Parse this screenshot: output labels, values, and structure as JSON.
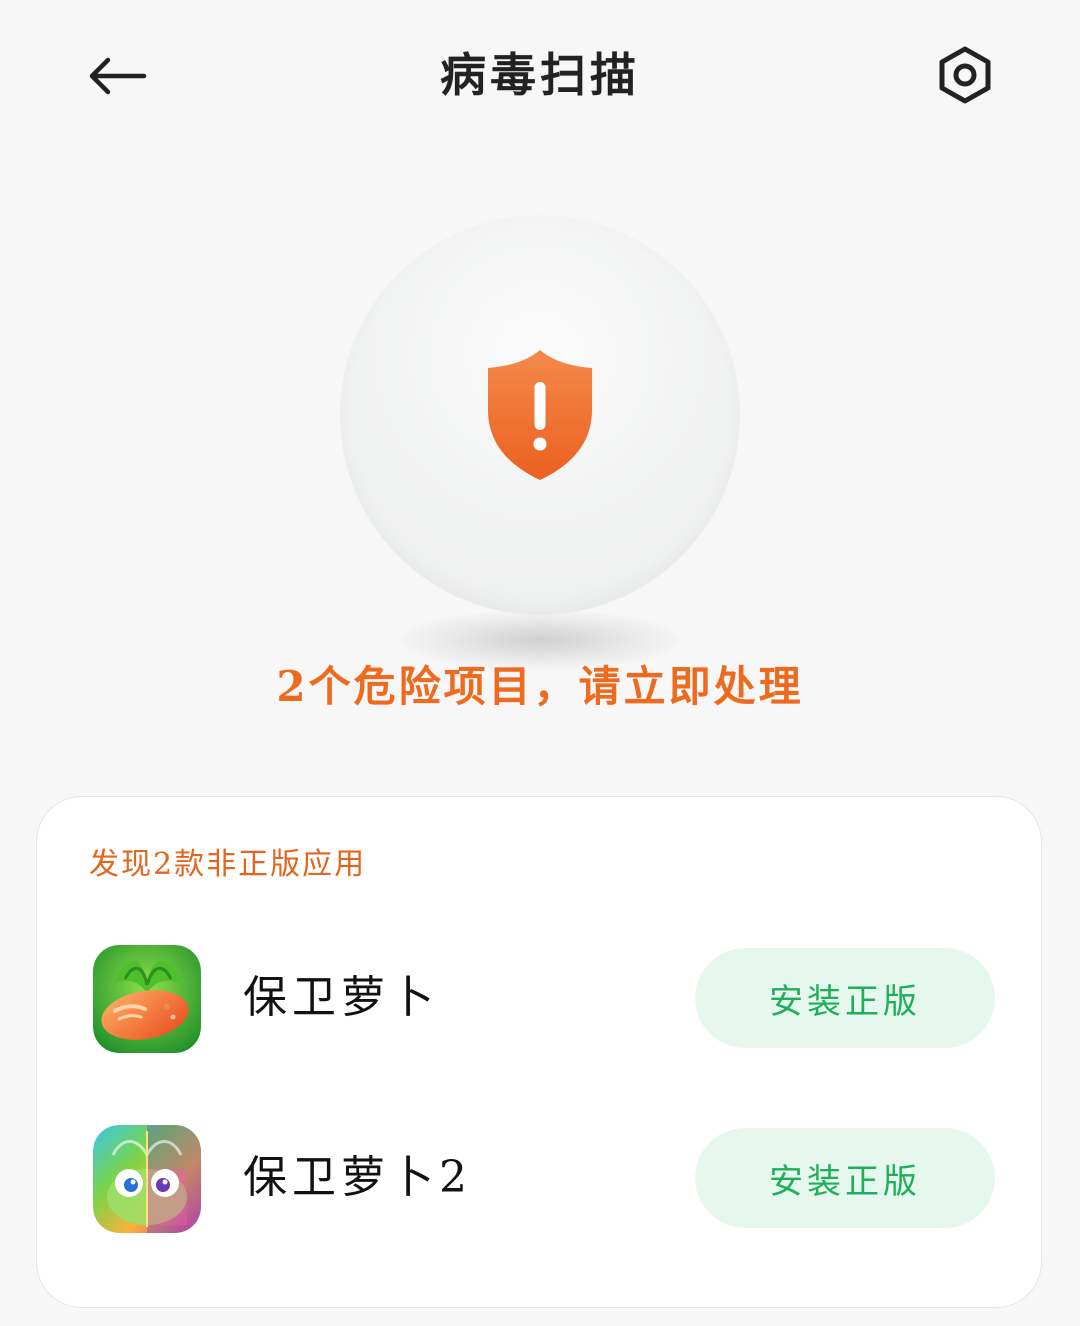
{
  "header": {
    "title": "病毒扫描",
    "back_icon": "arrow-left-icon",
    "settings_icon": "settings-hexagon-icon"
  },
  "status": {
    "icon": "shield-alert-icon",
    "message": "2个危险项目，请立即处理"
  },
  "card": {
    "heading": "发现2款非正版应用",
    "apps": [
      {
        "name": "保卫萝卜",
        "icon": "carrot-game-icon",
        "action_label": "安装正版"
      },
      {
        "name": "保卫萝卜2",
        "icon": "carrot-game-2-icon",
        "action_label": "安装正版"
      }
    ]
  },
  "colors": {
    "danger": "#ee6a1f",
    "heading": "#e4651e",
    "success_text": "#1fae5c",
    "success_bg": "#e6f8ee"
  }
}
